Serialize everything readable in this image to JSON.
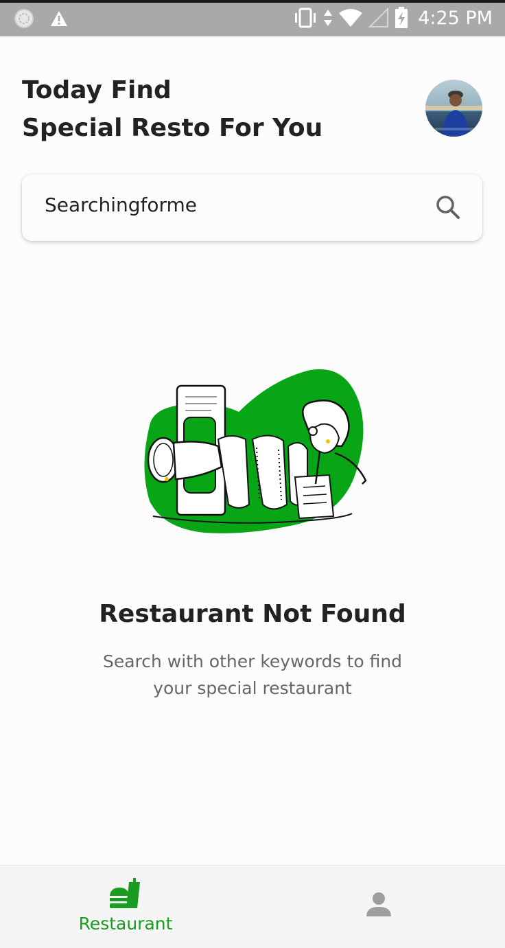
{
  "status_bar": {
    "time": "4:25 PM",
    "icons": [
      "sync-icon",
      "warning-icon",
      "vibrate-icon",
      "data-arrows-icon",
      "wifi-icon",
      "signal-icon",
      "battery-charging-icon"
    ]
  },
  "header": {
    "line1": "Today Find",
    "line2": "Special Resto For You"
  },
  "search": {
    "value": "Searchingforme",
    "icon": "search-icon"
  },
  "empty_state": {
    "title": "Restaurant Not Found",
    "description": "Search with other keywords to find your special restaurant"
  },
  "bottom_nav": {
    "items": [
      {
        "label": "Restaurant",
        "icon": "fastfood-icon",
        "active": true
      },
      {
        "label": "",
        "icon": "person-icon",
        "active": false
      }
    ]
  },
  "colors": {
    "accent": "#1a9c21",
    "illustration_green": "#08a516",
    "status_bar": "#a9a9a9",
    "inactive_icon": "#9e9e9e"
  }
}
